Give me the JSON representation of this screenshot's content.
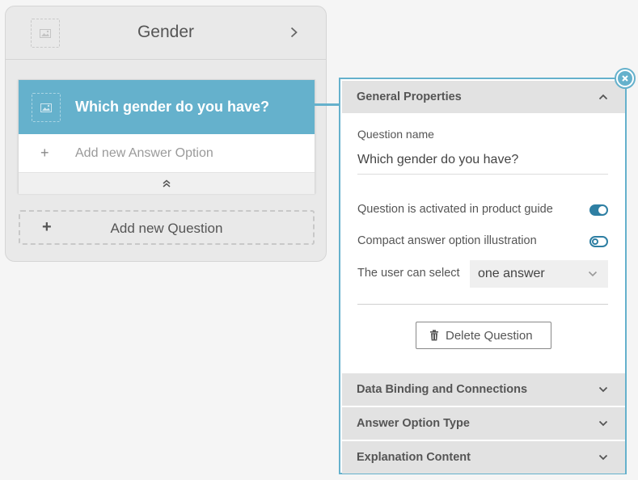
{
  "group": {
    "title": "Gender",
    "image_icon": "image-placeholder-icon",
    "expand_icon": "chevron-right-icon"
  },
  "question": {
    "title": "Which gender do you have?",
    "add_answer_label": "Add new Answer Option",
    "add_answer_icon": "plus-icon",
    "collapse_icon": "double-chevron-up-icon"
  },
  "add_question": {
    "label": "Add new Question",
    "icon": "plus-icon"
  },
  "panel": {
    "close_icon": "close-icon",
    "general": {
      "title": "General Properties",
      "expanded": true,
      "question_name_label": "Question name",
      "question_name_value": "Which gender do you have?",
      "activated_label": "Question is activated in product guide",
      "activated": true,
      "compact_label": "Compact answer option illustration",
      "compact": false,
      "select_label": "The user can select",
      "select_value": "one answer",
      "delete_label": "Delete Question"
    },
    "sections": [
      {
        "title": "Data Binding and Connections"
      },
      {
        "title": "Answer Option Type"
      },
      {
        "title": "Explanation Content"
      }
    ]
  },
  "colors": {
    "accent": "#65b1cc",
    "toggle": "#2e7fa3",
    "background": "#f5f5f5"
  }
}
